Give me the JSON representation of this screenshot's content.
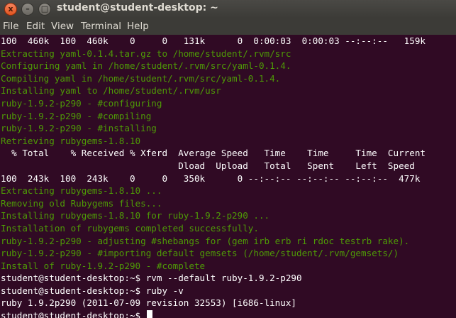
{
  "window": {
    "title": "student@student-desktop: ~",
    "controls": {
      "close": "x",
      "minimize": "–",
      "maximize": "□"
    }
  },
  "menu": [
    "File",
    "Edit",
    "View",
    "Terminal",
    "Help"
  ],
  "terminal": {
    "lines": [
      {
        "text": "100  460k  100  460k    0     0   131k      0  0:00:03  0:00:03 --:--:--   159k",
        "style": "normal"
      },
      {
        "text": "Extracting yaml-0.1.4.tar.gz to /home/student/.rvm/src",
        "style": "dim"
      },
      {
        "text": "Configuring yaml in /home/student/.rvm/src/yaml-0.1.4.",
        "style": "dim"
      },
      {
        "text": "Compiling yaml in /home/student/.rvm/src/yaml-0.1.4.",
        "style": "dim"
      },
      {
        "text": "Installing yaml to /home/student/.rvm/usr",
        "style": "dim"
      },
      {
        "text": "ruby-1.9.2-p290 - #configuring",
        "style": "dim"
      },
      {
        "text": "ruby-1.9.2-p290 - #compiling",
        "style": "dim"
      },
      {
        "text": "ruby-1.9.2-p290 - #installing",
        "style": "dim"
      },
      {
        "text": "Retrieving rubygems-1.8.10",
        "style": "dim"
      },
      {
        "text": "  % Total    % Received % Xferd  Average Speed   Time    Time     Time  Current",
        "style": "normal"
      },
      {
        "text": "                                 Dload  Upload   Total   Spent    Left  Speed",
        "style": "normal"
      },
      {
        "text": "100  243k  100  243k    0     0   350k      0 --:--:-- --:--:-- --:--:--  477k",
        "style": "normal"
      },
      {
        "text": "Extracting rubygems-1.8.10 ...",
        "style": "dim"
      },
      {
        "text": "Removing old Rubygems files...",
        "style": "dim"
      },
      {
        "text": "Installing rubygems-1.8.10 for ruby-1.9.2-p290 ...",
        "style": "dim"
      },
      {
        "text": "Installation of rubygems completed successfully.",
        "style": "dim"
      },
      {
        "text": "ruby-1.9.2-p290 - adjusting #shebangs for (gem irb erb ri rdoc testrb rake).",
        "style": "dim"
      },
      {
        "text": "ruby-1.9.2-p290 - #importing default gemsets (/home/student/.rvm/gemsets/)",
        "style": "dim"
      },
      {
        "text": "Install of ruby-1.9.2-p290 - #complete",
        "style": "dim"
      },
      {
        "text": "student@student-desktop:~$ rvm --default ruby-1.9.2-p290",
        "style": "normal"
      },
      {
        "text": "student@student-desktop:~$ ruby -v",
        "style": "normal"
      },
      {
        "text": "ruby 1.9.2p290 (2011-07-09 revision 32553) [i686-linux]",
        "style": "normal"
      }
    ],
    "prompt": "student@student-desktop:~$ "
  },
  "colors": {
    "terminal_bg": "#300a24",
    "terminal_fg": "#ffffff",
    "dim_text": "#4e9a06",
    "chrome_bg": "#3c3b37",
    "close_button": "#e0541f"
  }
}
